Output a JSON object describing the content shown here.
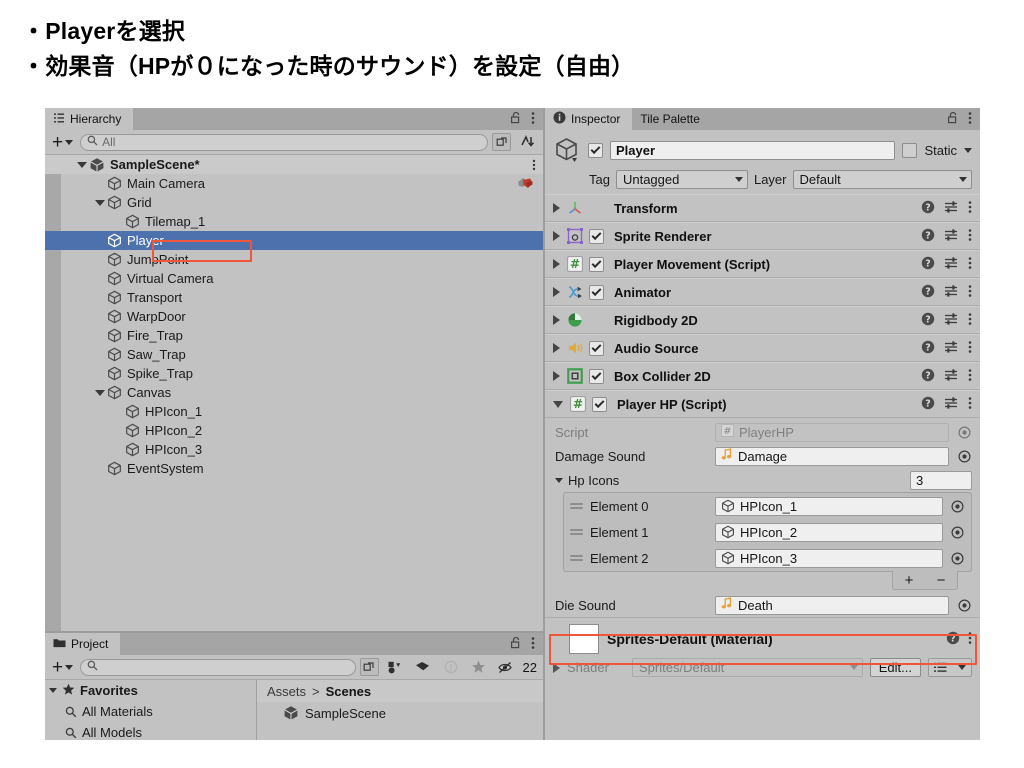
{
  "header": {
    "lines": [
      "・Playerを選択",
      "・効果音（HPが０になった時のサウンド）を設定（自由）"
    ]
  },
  "colors": {
    "selection_blue": "#4c71ad",
    "highlight_red": "#f0563a",
    "panel_bg": "#c2c2c2",
    "tabbar_bg": "#a5a5a5"
  },
  "hierarchy": {
    "tab_label": "Hierarchy",
    "search_placeholder": "All",
    "items": [
      {
        "label": "SampleScene*",
        "indent": 1,
        "expanded": true,
        "selected": false,
        "is_scene": true
      },
      {
        "label": "Main Camera",
        "indent": 2,
        "expanded": null,
        "selected": false,
        "is_scene": false
      },
      {
        "label": "Grid",
        "indent": 2,
        "expanded": true,
        "selected": false,
        "is_scene": false
      },
      {
        "label": "Tilemap_1",
        "indent": 3,
        "expanded": null,
        "selected": false,
        "is_scene": false
      },
      {
        "label": "Player",
        "indent": 2,
        "expanded": null,
        "selected": true,
        "is_scene": false
      },
      {
        "label": "JumpPoint",
        "indent": 2,
        "expanded": null,
        "selected": false,
        "is_scene": false
      },
      {
        "label": "Virtual Camera",
        "indent": 2,
        "expanded": null,
        "selected": false,
        "is_scene": false
      },
      {
        "label": "Transport",
        "indent": 2,
        "expanded": null,
        "selected": false,
        "is_scene": false
      },
      {
        "label": "WarpDoor",
        "indent": 2,
        "expanded": null,
        "selected": false,
        "is_scene": false
      },
      {
        "label": "Fire_Trap",
        "indent": 2,
        "expanded": null,
        "selected": false,
        "is_scene": false
      },
      {
        "label": "Saw_Trap",
        "indent": 2,
        "expanded": null,
        "selected": false,
        "is_scene": false
      },
      {
        "label": "Spike_Trap",
        "indent": 2,
        "expanded": null,
        "selected": false,
        "is_scene": false
      },
      {
        "label": "Canvas",
        "indent": 2,
        "expanded": true,
        "selected": false,
        "is_scene": false
      },
      {
        "label": "HPIcon_1",
        "indent": 3,
        "expanded": null,
        "selected": false,
        "is_scene": false
      },
      {
        "label": "HPIcon_2",
        "indent": 3,
        "expanded": null,
        "selected": false,
        "is_scene": false
      },
      {
        "label": "HPIcon_3",
        "indent": 3,
        "expanded": null,
        "selected": false,
        "is_scene": false
      },
      {
        "label": "EventSystem",
        "indent": 2,
        "expanded": null,
        "selected": false,
        "is_scene": false
      }
    ]
  },
  "project": {
    "tab_label": "Project",
    "search_placeholder": "",
    "hidden_count": "22",
    "favorites_label": "Favorites",
    "favorites": [
      "All Materials",
      "All Models"
    ],
    "breadcrumb": {
      "root": "Assets",
      "separator": ">",
      "current": "Scenes"
    },
    "assets": [
      "SampleScene"
    ]
  },
  "inspector": {
    "tabs": [
      {
        "label": "Inspector",
        "active": true
      },
      {
        "label": "Tile Palette",
        "active": false
      }
    ],
    "object": {
      "enabled": true,
      "name": "Player",
      "static_label": "Static",
      "static_checked": false,
      "tag_label": "Tag",
      "tag_value": "Untagged",
      "layer_label": "Layer",
      "layer_value": "Default"
    },
    "components": [
      {
        "name": "Transform",
        "icon": "transform-axis-icon",
        "has_toggle": false,
        "enabled": false,
        "expanded": false
      },
      {
        "name": "Sprite Renderer",
        "icon": "sprite-renderer-icon",
        "has_toggle": true,
        "enabled": true,
        "expanded": false
      },
      {
        "name": "Player Movement (Script)",
        "icon": "csharp-script-icon",
        "has_toggle": true,
        "enabled": true,
        "expanded": false
      },
      {
        "name": "Animator",
        "icon": "animator-icon",
        "has_toggle": true,
        "enabled": true,
        "expanded": false
      },
      {
        "name": "Rigidbody 2D",
        "icon": "rigidbody2d-icon",
        "has_toggle": false,
        "enabled": false,
        "expanded": false
      },
      {
        "name": "Audio Source",
        "icon": "audio-source-icon",
        "has_toggle": true,
        "enabled": true,
        "expanded": false
      },
      {
        "name": "Box Collider 2D",
        "icon": "box-collider2d-icon",
        "has_toggle": true,
        "enabled": true,
        "expanded": false
      },
      {
        "name": "Player HP (Script)",
        "icon": "csharp-script-icon",
        "has_toggle": true,
        "enabled": true,
        "expanded": true
      }
    ],
    "player_hp": {
      "script_label": "Script",
      "script_value": "PlayerHP",
      "damage_sound_label": "Damage Sound",
      "damage_sound_value": "Damage",
      "hp_icons_label": "Hp Icons",
      "hp_icons_size": "3",
      "elements": [
        {
          "label": "Element 0",
          "value": "HPIcon_1"
        },
        {
          "label": "Element 1",
          "value": "HPIcon_2"
        },
        {
          "label": "Element 2",
          "value": "HPIcon_3"
        }
      ],
      "add_button": "+",
      "remove_button": "−",
      "die_sound_label": "Die Sound",
      "die_sound_value": "Death"
    },
    "material": {
      "title": "Sprites-Default (Material)",
      "shader_label": "Shader",
      "shader_value": "Sprites/Default",
      "edit_button": "Edit..."
    }
  }
}
